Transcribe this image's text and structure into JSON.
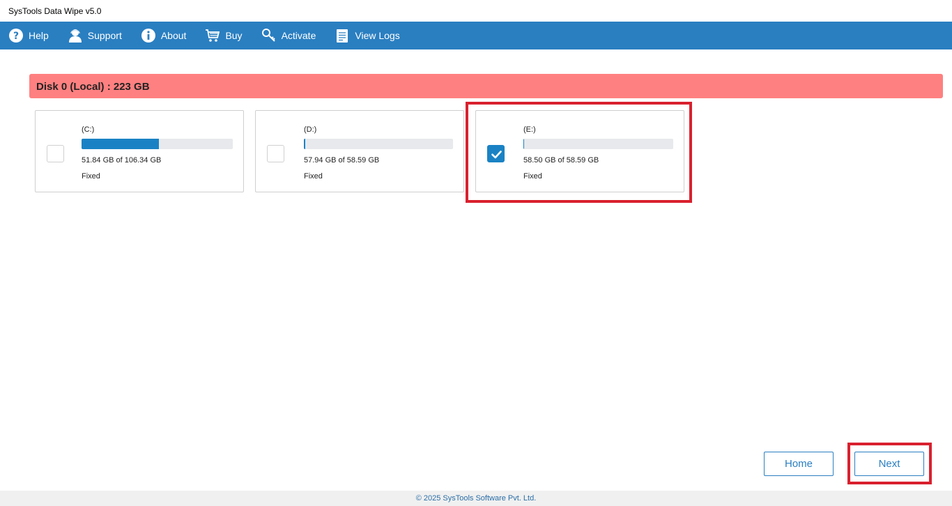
{
  "window": {
    "title": "SysTools Data Wipe v5.0"
  },
  "toolbar": {
    "items": [
      {
        "label": "Help",
        "icon": "help-icon"
      },
      {
        "label": "Support",
        "icon": "support-icon"
      },
      {
        "label": "About",
        "icon": "info-icon"
      },
      {
        "label": "Buy",
        "icon": "cart-icon"
      },
      {
        "label": "Activate",
        "icon": "key-icon"
      },
      {
        "label": "View Logs",
        "icon": "log-icon"
      }
    ]
  },
  "disk": {
    "header": "Disk 0 (Local) : 223 GB",
    "drives": [
      {
        "label": "(C:)",
        "size": "51.84 GB of 106.34 GB",
        "type": "Fixed",
        "used_fraction": 0.513,
        "checked": false
      },
      {
        "label": "(D:)",
        "size": "57.94 GB of 58.59 GB",
        "type": "Fixed",
        "used_fraction": 0.011,
        "checked": false
      },
      {
        "label": "(E:)",
        "size": "58.50 GB of 58.59 GB",
        "type": "Fixed",
        "used_fraction": 0.0015,
        "checked": true
      }
    ]
  },
  "buttons": {
    "home": "Home",
    "next": "Next"
  },
  "footer": {
    "copyright": "© 2025 SysTools Software Pvt. Ltd."
  },
  "colors": {
    "toolbar": "#2a7fc1",
    "disk_header": "#ff8080",
    "accent": "#1a82c4",
    "highlight": "#d9202e"
  }
}
